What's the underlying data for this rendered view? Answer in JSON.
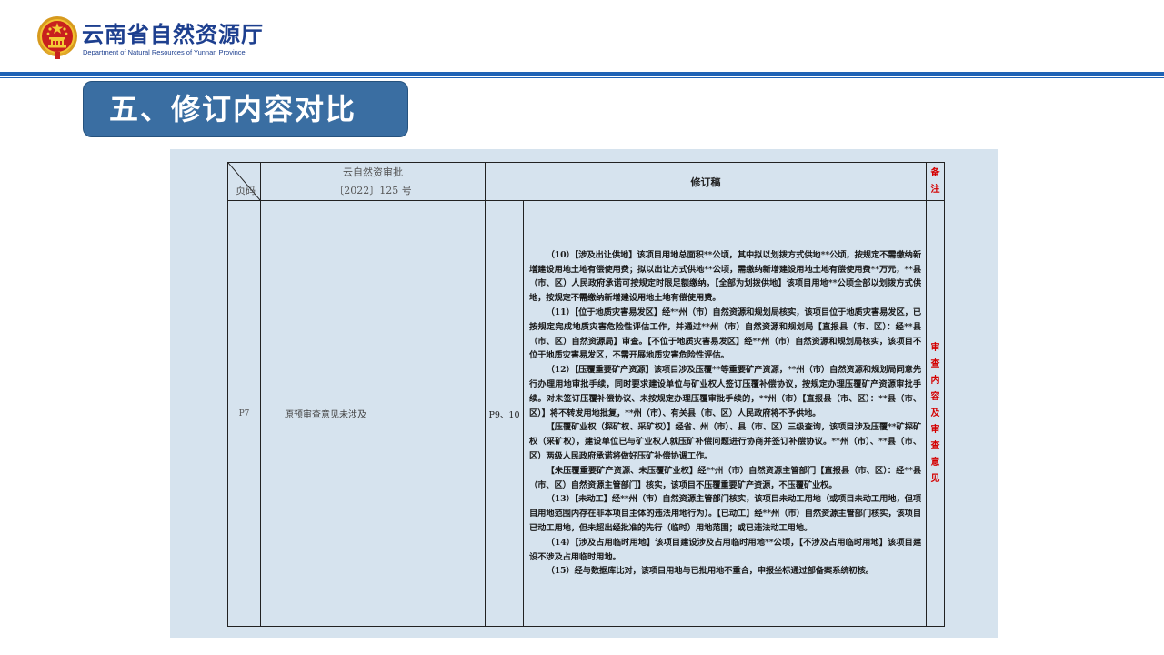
{
  "header": {
    "org_name_cn": "云南省自然资源厅",
    "org_name_en": "Department of Natural Resources of Yunnan Province",
    "emblem_icon": "national-emblem-icon",
    "accent_color": "#1f63b5"
  },
  "section": {
    "title": "五、修订内容对比",
    "title_bg_color": "#3a6ea2"
  },
  "table": {
    "header": {
      "corner_label": "页码",
      "original_line1": "云自然资审批",
      "original_line2": "〔2022〕125 号",
      "revised": "修订稿",
      "note": "备注"
    },
    "row": {
      "page": "P7",
      "original": "原预审查意见未涉及",
      "revised_pages": "P9、10",
      "paragraphs": [
        "（10）【涉及出让供地】该项目用地总面积**公顷，其中拟以划拨方式供地**公顷，按规定不需缴纳新增建设用地土地有偿使用费；拟以出让方式供地**公顷，需缴纳新增建设用地土地有偿使用费**万元，**县（市、区）人民政府承诺可按规定时限足额缴纳。【全部为划拨供地】该项目用地**公顷全部以划拨方式供地，按规定不需缴纳新增建设用地土地有偿使用费。",
        "（11）【位于地质灾害易发区】经**州（市）自然资源和规划局核实，该项目位于地质灾害易发区，已按规定完成地质灾害危险性评估工作，并通过**州（市）自然资源和规划局【直报县（市、区）：经**县（市、区）自然资源局】审查。【不位于地质灾害易发区】经**州（市）自然资源和规划局核实，该项目不位于地质灾害易发区，不需开展地质灾害危险性评估。",
        "（12）【压覆重要矿产资源】该项目涉及压覆**等重要矿产资源，**州（市）自然资源和规划局同意先行办理用地审批手续，同时要求建设单位与矿业权人签订压覆补偿协议，按规定办理压覆矿产资源审批手续。对未签订压覆补偿协议、未按规定办理压覆审批手续的，**州（市）【直报县（市、区）：**县（市、区）】将不转发用地批复，**州（市）、有关县（市、区）人民政府将不予供地。",
        "【压覆矿业权（探矿权、采矿权）】经省、州（市）、县（市、区）三级查询，该项目涉及压覆**矿探矿权（采矿权），建设单位已与矿业权人就压矿补偿问题进行协商并签订补偿协议。**州（市）、**县（市、区）两级人民政府承诺将做好压矿补偿协调工作。",
        "【未压覆重要矿产资源、未压覆矿业权】经**州（市）自然资源主管部门【直报县（市、区）：经**县（市、区）自然资源主管部门】核实，该项目不压覆重要矿产资源，不压覆矿业权。",
        "（13）【未动工】经**州（市）自然资源主管部门核实，该项目未动工用地（或项目未动工用地，但项目用地范围内存在非本项目主体的违法用地行为）。【已动工】经**州（市）自然资源主管部门核实，该项目已动工用地，但未超出经批准的先行（临时）用地范围；或已违法动工用地。",
        "（14）【涉及占用临时用地】该项目建设涉及占用临时用地**公顷，【不涉及占用临时用地】该项目建设不涉及占用临时用地。",
        "（15）经与数据库比对，该项目用地与已批用地不重合，申报坐标通过部备案系统初核。"
      ],
      "note": "审查内容及审查意见"
    },
    "note_color": "#d40000"
  }
}
